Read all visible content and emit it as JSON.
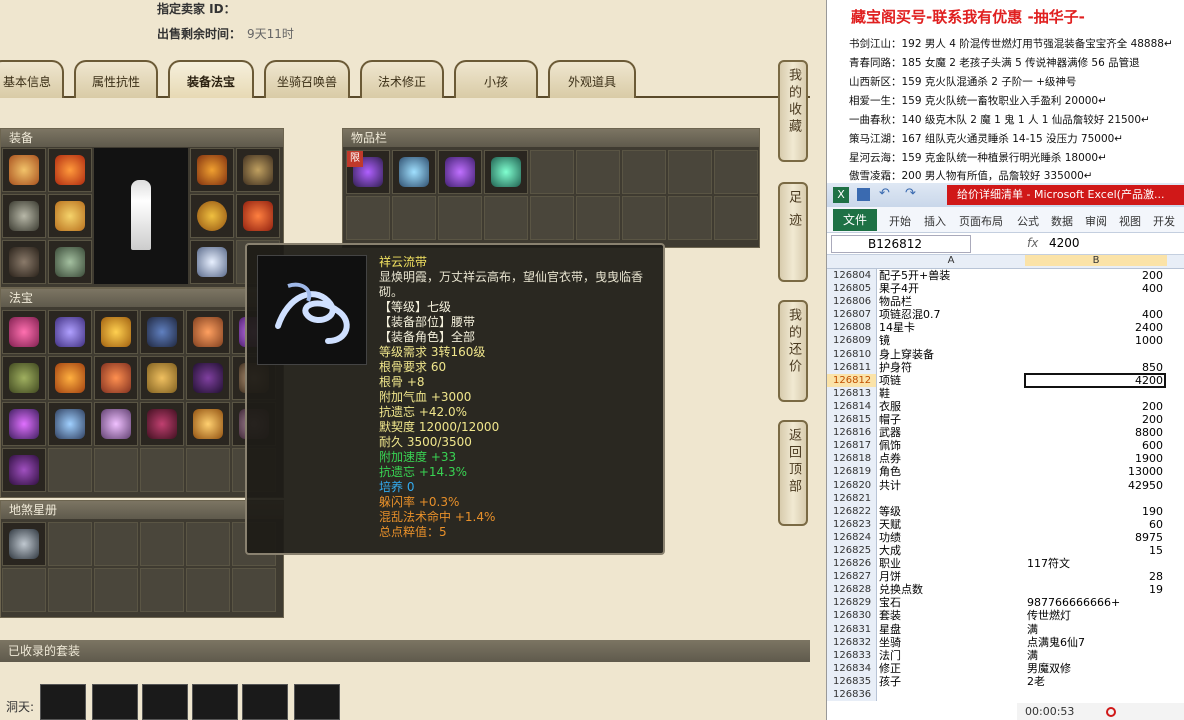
{
  "seller": {
    "designated_label": "指定卖家 ID：",
    "time_label": "出售剩余时间：",
    "time_value": "9天11时"
  },
  "tabs": [
    "基本信息",
    "属性抗性",
    "装备法宝",
    "坐骑召唤兽",
    "法术修正",
    "小孩",
    "外观道具"
  ],
  "active_tab": 2,
  "panels": {
    "equipment": "装备",
    "inventory": "物品栏",
    "treasure": "法宝",
    "stars": "地煞星册",
    "suits": "已收录的套装",
    "suits_row_label": "洞天:"
  },
  "inventory_limit_badge": "限",
  "side_buttons": [
    "我的收藏",
    "足迹",
    "我的还价",
    "返回顶部"
  ],
  "tooltip": {
    "name": "祥云流带",
    "desc": "显焕明霞，万丈祥云高布，望仙官衣带，曳曳临香砌。",
    "lines": [
      {
        "text": "【等级】七级",
        "color": "#f4f0dc"
      },
      {
        "text": "【装备部位】腰带",
        "color": "#f4f0dc"
      },
      {
        "text": "【装备角色】全部",
        "color": "#f4f0dc"
      },
      {
        "text": "等级需求 3转160级",
        "color": "#f0e68c"
      },
      {
        "text": "根骨要求 60",
        "color": "#f0e68c"
      },
      {
        "text": "根骨 +8",
        "color": "#f0e68c"
      },
      {
        "text": "附加气血 +3000",
        "color": "#f0e68c"
      },
      {
        "text": "抗遗忘 +42.0%",
        "color": "#f0e68c"
      },
      {
        "text": "默契度 12000/12000",
        "color": "#f0e68c"
      },
      {
        "text": "耐久 3500/3500",
        "color": "#f0e68c"
      },
      {
        "text": "附加速度 +33",
        "color": "#39d353"
      },
      {
        "text": "抗遗忘 +14.3%",
        "color": "#39d353"
      },
      {
        "text": "培养 0",
        "color": "#33aaee"
      },
      {
        "text": "躲闪率 +0.3%",
        "color": "#e8902a"
      },
      {
        "text": "混乱法术命中 +1.4%",
        "color": "#e8902a"
      },
      {
        "text": "总点粹值：5",
        "color": "#e8902a"
      }
    ]
  },
  "notes": {
    "title": "藏宝阁买号-联系我有优惠 -抽华子-",
    "lines": [
      "书剑江山：192 男人 4 阶混传世燃灯用节强混装备宝宝齐全 48888↵",
      "青春同路：185 女魔 2 老孩子头满 5 传说神器满修 56 品管退",
      "山西新区：159 克火队混通杀 2 子阶一 +级神号",
      "相爱一生：159 克火队统一畜牧职业入手盈利 20000↵",
      "一曲春秋：140 级克木队 2 魔 1 鬼 1 人 1 仙品詹较好 21500↵",
      "策马江湖：167 组队克火通灵睡杀 14-15 没压力 75000↵",
      "星河云海：159 克金队统一种植景行明光睡杀 18000↵",
      "傲雪凌霜：200 男人物有所值，品詹较好 335000↵"
    ]
  },
  "excel": {
    "title": "给价详细清单 - Microsoft Excel(产品激...",
    "menu": [
      "文件",
      "开始",
      "插入",
      "页面布局",
      "公式",
      "数据",
      "审阅",
      "视图",
      "开发工"
    ],
    "name_box": "B126812",
    "fx": "fx",
    "formula_value": "4200",
    "col_a": "A",
    "col_b": "B",
    "selected_row": "126812",
    "rows": [
      [
        "126804",
        "配子5开+兽装",
        "200"
      ],
      [
        "126805",
        "果子4开",
        "400"
      ],
      [
        "126806",
        "物品栏",
        ""
      ],
      [
        "126807",
        "项链忍混0.7",
        "400"
      ],
      [
        "126808",
        "14星卡",
        "2400"
      ],
      [
        "126809",
        "镜",
        "1000"
      ],
      [
        "126810",
        "身上穿装备",
        ""
      ],
      [
        "126811",
        "护身符",
        "850"
      ],
      [
        "126812",
        "项链",
        "4200"
      ],
      [
        "126813",
        "鞋",
        ""
      ],
      [
        "126814",
        "衣服",
        "200"
      ],
      [
        "126815",
        "帽子",
        "200"
      ],
      [
        "126816",
        "武器",
        "8800"
      ],
      [
        "126817",
        "佩饰",
        "600"
      ],
      [
        "126818",
        "点券",
        "1900"
      ],
      [
        "126819",
        "角色",
        "13000"
      ],
      [
        "126820",
        "共计",
        "42950"
      ],
      [
        "126821",
        "",
        ""
      ],
      [
        "126822",
        "等级",
        "190"
      ],
      [
        "126823",
        "天赋",
        "60"
      ],
      [
        "126824",
        "功绩",
        "8975"
      ],
      [
        "126825",
        "大成",
        "15"
      ],
      [
        "126826",
        "职业",
        "117符文"
      ],
      [
        "126827",
        "月饼",
        "28"
      ],
      [
        "126828",
        "兑换点数",
        "19"
      ],
      [
        "126829",
        "宝石",
        "987766666666+"
      ],
      [
        "126830",
        "套装",
        "传世燃灯"
      ],
      [
        "126831",
        "星盘",
        "满"
      ],
      [
        "126832",
        "坐骑",
        "点满鬼6仙7"
      ],
      [
        "126833",
        "法门",
        "满"
      ],
      [
        "126834",
        "修正",
        "男魔双修"
      ],
      [
        "126835",
        "孩子",
        "2老"
      ],
      [
        "126836",
        "",
        ""
      ]
    ],
    "status_time": "00:00:53"
  }
}
